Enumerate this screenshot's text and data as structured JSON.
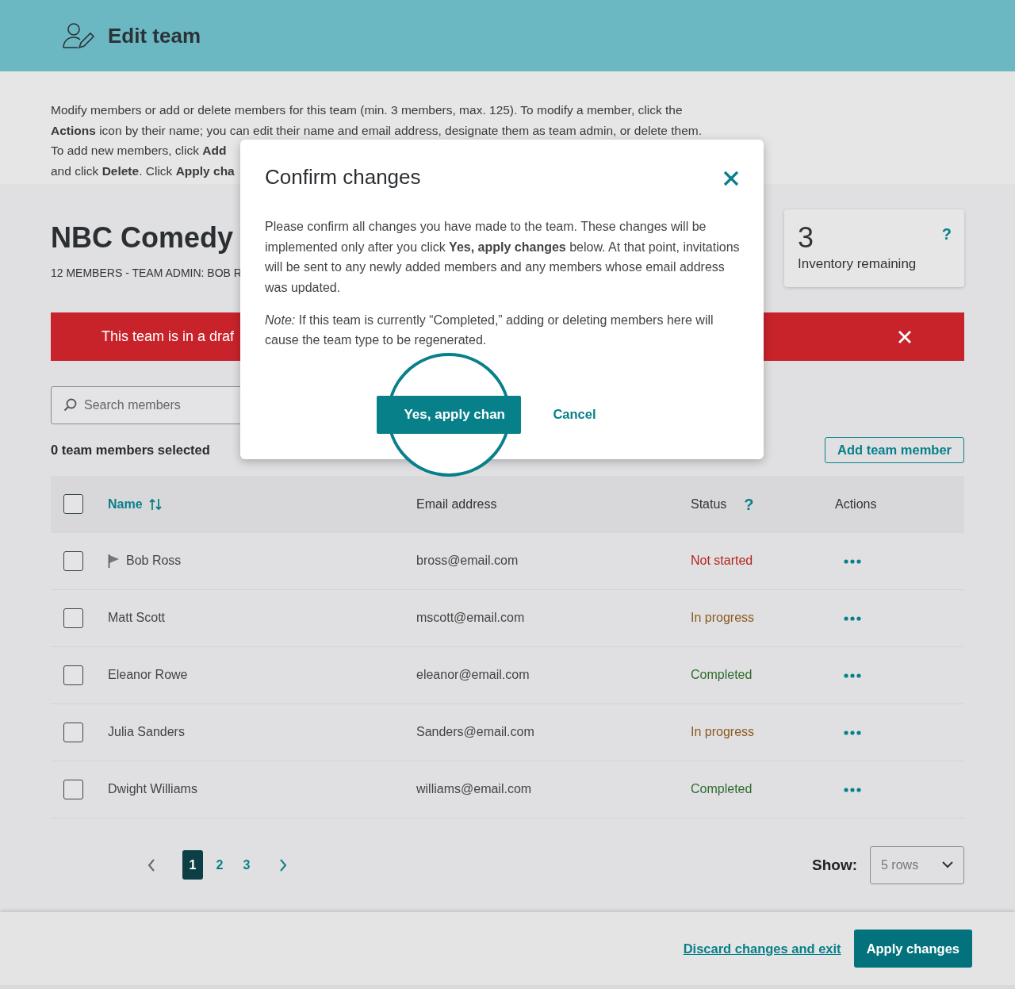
{
  "header": {
    "title": "Edit team"
  },
  "intro": {
    "lines": [
      "Modify members or add or delete members for this team (min. 3 members, max. 125). To modify a member, click the",
      "**Actions** icon by their name; you can edit their name and email address, designate them as team admin, or delete them.",
      "To add new members, click **Add**",
      "and click **Delete**. Click **Apply cha**"
    ]
  },
  "team": {
    "name": "NBC Comedy",
    "subtitle": "12 MEMBERS - TEAM ADMIN: BOB R"
  },
  "inventory": {
    "count": "3",
    "label": "Inventory remaining",
    "help": "?"
  },
  "alert": {
    "text": "This team is in a draf"
  },
  "search": {
    "placeholder": "Search members"
  },
  "selection_count": "0 team members selected",
  "add_button": "Add team member",
  "table": {
    "select_all_checked": false,
    "columns": [
      {
        "label": "Name",
        "sortable": true
      },
      {
        "label": "Email address",
        "sortable": false
      },
      {
        "label": "Status",
        "sortable": false,
        "help": "?"
      },
      {
        "label": "Actions",
        "sortable": false
      }
    ],
    "rows": [
      {
        "checked": false,
        "flagged": true,
        "name": "Bob Ross",
        "email": "bross@email.com",
        "status": "Not started",
        "color": "#b3261e"
      },
      {
        "checked": false,
        "flagged": false,
        "name": "Matt Scott",
        "email": "mscott@email.com",
        "status": "In progress",
        "color": "#8a5a1e"
      },
      {
        "checked": false,
        "flagged": false,
        "name": "Eleanor Rowe",
        "email": "eleanor@email.com",
        "status": "Completed",
        "color": "#2e6b2e"
      },
      {
        "checked": false,
        "flagged": false,
        "name": "Julia Sanders",
        "email": "Sanders@email.com",
        "status": "In progress",
        "color": "#8a5a1e"
      },
      {
        "checked": false,
        "flagged": false,
        "name": "Dwight Williams",
        "email": "williams@email.com",
        "status": "Completed",
        "color": "#2e6b2e"
      }
    ]
  },
  "pagination": {
    "pages": [
      {
        "label": "1",
        "selected": true
      },
      {
        "label": "2",
        "selected": false
      },
      {
        "label": "3",
        "selected": false
      }
    ]
  },
  "show": {
    "label": "Show:",
    "value": "5 rows"
  },
  "footer": {
    "discard": "Discard changes and exit",
    "apply": "Apply changes"
  },
  "modal": {
    "title": "Confirm changes",
    "paragraphs": [
      "Please confirm all changes you have made to the team. These changes will be implemented only after you click **Yes, apply changes** below. At that point, invitations will be sent to any newly added members and any members whose email address was updated.",
      "*Note:* If this team is currently “Completed,” adding or deleting members here will cause the team type to be regenerated."
    ],
    "confirm": "Yes, apply chan",
    "cancel": "Cancel"
  }
}
